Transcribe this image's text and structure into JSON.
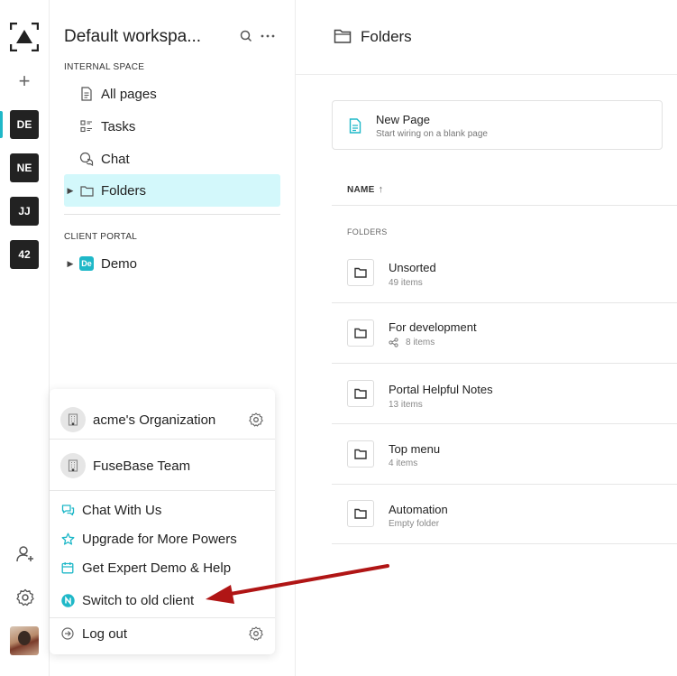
{
  "rail": {
    "add_label": "+",
    "workspaces": [
      "DE",
      "NE",
      "JJ",
      "42"
    ]
  },
  "sidebar": {
    "workspace_title": "Default workspa...",
    "internal_label": "INTERNAL SPACE",
    "items": [
      {
        "label": "All pages",
        "icon": "document-icon"
      },
      {
        "label": "Tasks",
        "icon": "tasks-icon"
      },
      {
        "label": "Chat",
        "icon": "chat-icon"
      },
      {
        "label": "Folders",
        "icon": "folder-icon"
      }
    ],
    "client_label": "CLIENT PORTAL",
    "portal": {
      "label": "Demo",
      "badge": "De"
    }
  },
  "popup": {
    "orgs": [
      {
        "name": "acme's Organization"
      },
      {
        "name": "FuseBase Team"
      }
    ],
    "menu": [
      {
        "label": "Chat With Us"
      },
      {
        "label": "Upgrade for More Powers"
      },
      {
        "label": "Get Expert Demo & Help"
      },
      {
        "label": "Switch to old client"
      }
    ],
    "logout": "Log out"
  },
  "main": {
    "title": "Folders",
    "new_page": {
      "title": "New Page",
      "subtitle": "Start wiring on a blank page"
    },
    "column_name": "NAME",
    "folders_label": "FOLDERS",
    "folders": [
      {
        "name": "Unsorted",
        "meta": "49 items"
      },
      {
        "name": "For development",
        "meta": "8 items"
      },
      {
        "name": "Portal Helpful Notes",
        "meta": "13 items"
      },
      {
        "name": "Top menu",
        "meta": "4 items"
      },
      {
        "name": "Automation",
        "meta": "Empty folder"
      }
    ]
  },
  "colors": {
    "accent": "#1fb8c8",
    "active_bg": "#d3f8fb",
    "arrow": "#b01515"
  }
}
